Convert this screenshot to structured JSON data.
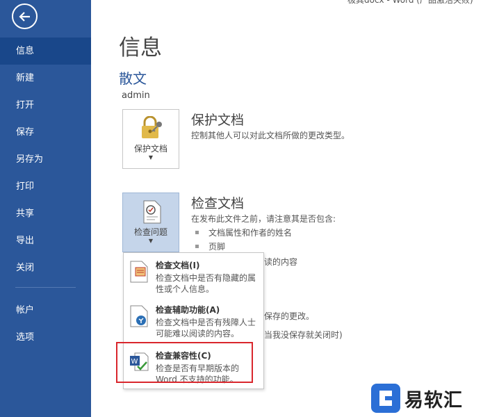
{
  "window": {
    "title": "极其docx - Word (产品激活失败)"
  },
  "sidebar": {
    "items": [
      {
        "label": "信息"
      },
      {
        "label": "新建"
      },
      {
        "label": "打开"
      },
      {
        "label": "保存"
      },
      {
        "label": "另存为"
      },
      {
        "label": "打印"
      },
      {
        "label": "共享"
      },
      {
        "label": "导出"
      },
      {
        "label": "关闭"
      },
      {
        "label": "帐户"
      },
      {
        "label": "选项"
      }
    ]
  },
  "main": {
    "title": "信息",
    "doc_name": "散文",
    "author": "admin",
    "protect": {
      "button_label": "保护文档",
      "title": "保护文档",
      "description": "控制其他人可以对此文档所做的更改类型。"
    },
    "inspect": {
      "button_label": "检查问题",
      "title": "检查文档",
      "description": "在发布此文件之前，请注意其是否包含:",
      "bullets": [
        "文档属性和作者的姓名",
        "页脚",
        "阅读的内容"
      ]
    },
    "versions_text": "保存的更改。",
    "autosave_text": "当我没保存就关闭时)"
  },
  "dropdown": {
    "items": [
      {
        "title": "检查文档(I)",
        "description": "检查文档中是否有隐藏的属性或个人信息。"
      },
      {
        "title": "检查辅助功能(A)",
        "description": "检查文档中是否有残障人士可能难以阅读的内容。"
      },
      {
        "title": "检查兼容性(C)",
        "description": "检查是否有早期版本的 Word 不支持的功能。"
      }
    ]
  },
  "watermark": {
    "text": "易软汇"
  },
  "colors": {
    "sidebar": "#2b579a",
    "active": "#19478a",
    "highlight": "#d9262c"
  }
}
